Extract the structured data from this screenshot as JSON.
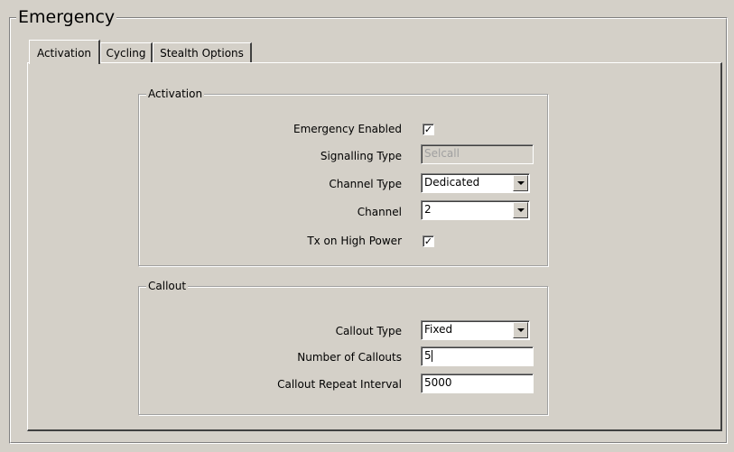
{
  "window": {
    "title": "Emergency"
  },
  "tabs": [
    {
      "label": "Activation",
      "active": true
    },
    {
      "label": "Cycling",
      "active": false
    },
    {
      "label": "Stealth Options",
      "active": false
    }
  ],
  "activation": {
    "title": "Activation",
    "emergency_enabled": {
      "label": "Emergency Enabled",
      "checked": true
    },
    "signalling_type": {
      "label": "Signalling Type",
      "value": "Selcall",
      "disabled": true
    },
    "channel_type": {
      "label": "Channel Type",
      "value": "Dedicated"
    },
    "channel": {
      "label": "Channel",
      "value": "2"
    },
    "tx_high_power": {
      "label": "Tx on High Power",
      "checked": true
    }
  },
  "callout": {
    "title": "Callout",
    "callout_type": {
      "label": "Callout Type",
      "value": "Fixed"
    },
    "number_of_callouts": {
      "label": "Number of Callouts",
      "value": "5"
    },
    "callout_repeat_interval": {
      "label": "Callout Repeat Interval",
      "value": "5000"
    }
  },
  "icons": {
    "checkmark": "✓",
    "dropdown": "chevron-down-icon"
  }
}
